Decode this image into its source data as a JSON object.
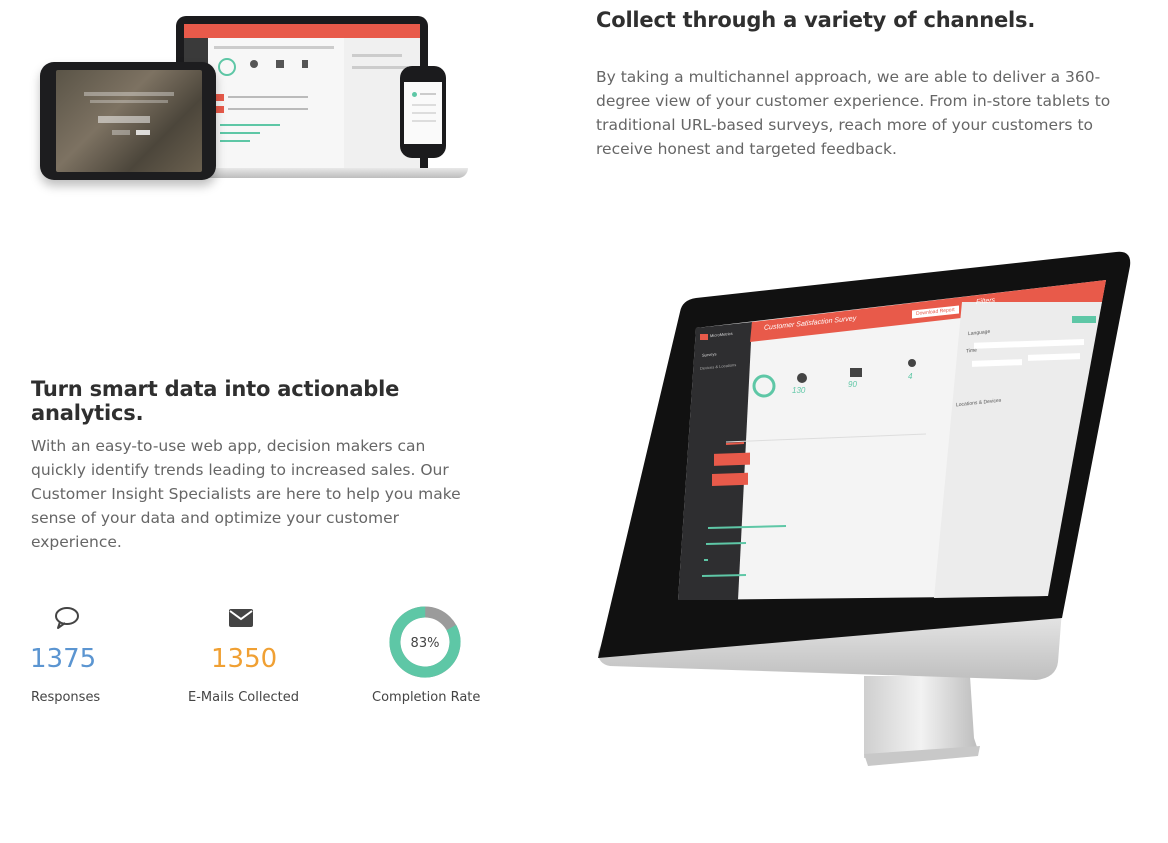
{
  "section1": {
    "heading": "Collect through a variety of channels.",
    "paragraph": "By taking a multichannel approach, we are able to deliver a 360-degree view of your customer experience. From in-store tablets to traditional URL-based surveys, reach more of your customers to receive honest and targeted feedback."
  },
  "section2": {
    "heading": "Turn smart data into actionable analytics.",
    "paragraph": "With an easy-to-use web app, decision makers can quickly identify trends leading to increased sales. Our Customer Insight Specialists are here to help you make sense of your data and optimize your customer experience."
  },
  "stats": [
    {
      "icon": "speech-bubble-icon",
      "value": "1375",
      "label": "Responses",
      "color": "#5b95d1"
    },
    {
      "icon": "envelope-icon",
      "value": "1350",
      "label": "E-Mails Collected",
      "color": "#f0a033"
    },
    {
      "icon": "donut-chart",
      "value": "83%",
      "label": "Completion Rate",
      "percent": 83,
      "color": "#5ec7a6",
      "track": "#9b9b9b"
    }
  ],
  "imac_screen": {
    "app_name": "MicroMetrics",
    "title": "Customer Satisfaction Survey",
    "download_button": "Download Report",
    "filters_label": "Filters",
    "nav": [
      "Surveys",
      "Devices & Locations"
    ],
    "date_deployed": "Date Deployed: 27/03/2014",
    "latest_response": "Latest Response: 27/03/2014",
    "metrics": [
      {
        "value": "100%",
        "label": "Completion Rate"
      },
      {
        "value": "130",
        "label": "Responses"
      },
      {
        "value": "90",
        "label": "E-mails Collected"
      },
      {
        "value": "4",
        "label": "Locations"
      }
    ],
    "tabs": [
      "Report",
      "Responses"
    ],
    "questions": [
      "This is a sample question; we're amazingable",
      "What does a sample question look like?"
    ],
    "table_headers": [
      "Response",
      "Percentage",
      "Amount"
    ],
    "rows": [
      {
        "label": "Kingston Road",
        "pct": "51%",
        "amt": "21"
      },
      {
        "label": "Yonghat Road",
        "pct": "25%",
        "amt": "16"
      },
      {
        "label": "Albion Road",
        "pct": "0%",
        "amt": "9"
      },
      {
        "label": "Black Creek Drive",
        "pct": "25%",
        "amt": "15"
      }
    ],
    "filter_language": "Language",
    "filter_time": "Time",
    "filter_locations": "Locations & Devices",
    "clear": "Clear"
  }
}
